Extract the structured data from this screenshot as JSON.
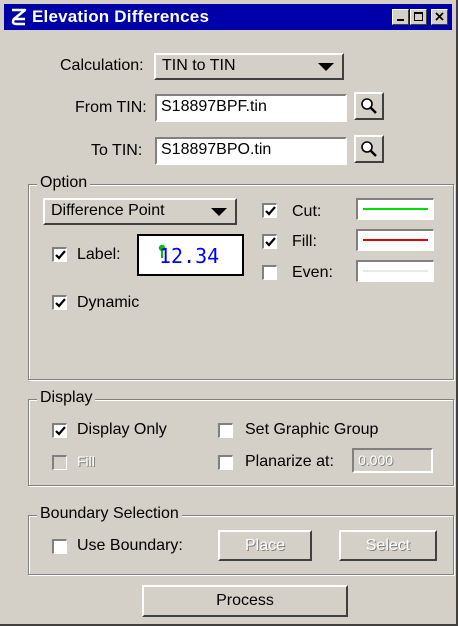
{
  "window": {
    "title": "Elevation Differences",
    "title_color": "#0000a8"
  },
  "calculation": {
    "label": "Calculation:",
    "value": "TIN to TIN"
  },
  "from_tin": {
    "label": "From TIN:",
    "value": "S18897BPF.tin"
  },
  "to_tin": {
    "label": "To TIN:",
    "value": "S18897BPO.tin"
  },
  "option": {
    "legend": "Option",
    "mode": "Difference Point",
    "label_checkbox": {
      "label": "Label:",
      "checked": true
    },
    "label_preview": {
      "text": "12.34",
      "color": "#0000ff",
      "marker_color": "#00c000"
    },
    "dynamic": {
      "label": "Dynamic",
      "checked": true
    },
    "cut": {
      "label": "Cut:",
      "checked": true,
      "color": "#00e000"
    },
    "fill": {
      "label": "Fill:",
      "checked": true,
      "color": "#e00000"
    },
    "even": {
      "label": "Even:",
      "checked": false,
      "color": "#e8e8e8"
    }
  },
  "display": {
    "legend": "Display",
    "display_only": {
      "label": "Display Only",
      "checked": true
    },
    "fill": {
      "label": "Fill",
      "checked": false,
      "enabled": false
    },
    "set_graphic_group": {
      "label": "Set Graphic Group",
      "checked": false
    },
    "planarize": {
      "label": "Planarize at:",
      "checked": false,
      "value": "0.000"
    }
  },
  "boundary": {
    "legend": "Boundary Selection",
    "use_boundary": {
      "label": "Use Boundary:",
      "checked": false
    },
    "place_label": "Place",
    "select_label": "Select"
  },
  "process_label": "Process"
}
